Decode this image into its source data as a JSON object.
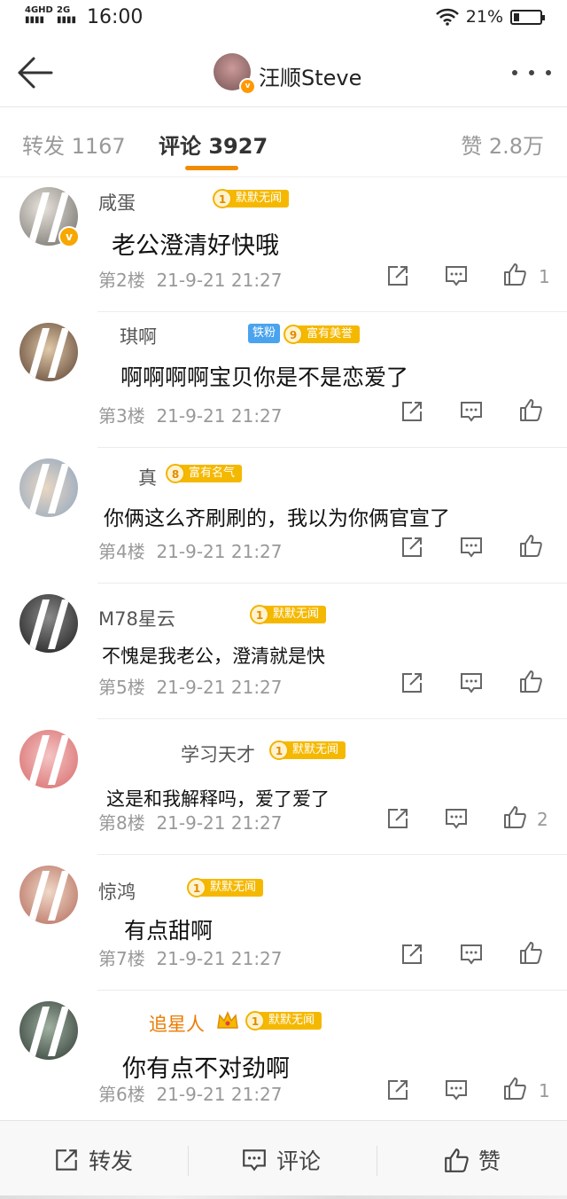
{
  "status_bar": {
    "net1": "4GHD",
    "net2": "2G",
    "time": "16:00",
    "battery": "21%"
  },
  "header": {
    "title": "汪顺Steve",
    "verified_mark": "v"
  },
  "tabs": [
    {
      "label": "转发 1167",
      "active": false
    },
    {
      "label": "评论 3927",
      "active": true
    },
    {
      "label": "赞 2.8万",
      "active": false
    }
  ],
  "comments": [
    {
      "name": "咸蛋",
      "badge_level": "1",
      "badge_text": "默默无闻",
      "text": "老公澄清好快哦",
      "floor": "第2楼",
      "time": "21-9-21 21:27",
      "likes": "1",
      "verified": "v"
    },
    {
      "name": "琪啊",
      "fan_tag": "铁粉",
      "badge_level": "9",
      "badge_text": "富有美誉",
      "text": "啊啊啊啊宝贝你是不是恋爱了",
      "floor": "第3楼",
      "time": "21-9-21 21:27",
      "likes": ""
    },
    {
      "name": "真",
      "badge_level": "8",
      "badge_text": "富有名气",
      "text": "你俩这么齐刷刷的，我以为你俩官宣了",
      "floor": "第4楼",
      "time": "21-9-21 21:27",
      "likes": ""
    },
    {
      "name": "M78星云",
      "badge_level": "1",
      "badge_text": "默默无闻",
      "text": "不愧是我老公，澄清就是快",
      "floor": "第5楼",
      "time": "21-9-21 21:27",
      "likes": ""
    },
    {
      "name": "学习天才",
      "badge_level": "1",
      "badge_text": "默默无闻",
      "text": "这是和我解释吗，爱了爱了",
      "floor": "第8楼",
      "time": "21-9-21 21:27",
      "likes": "2"
    },
    {
      "name": "惊鸿",
      "badge_level": "1",
      "badge_text": "默默无闻",
      "text": "有点甜啊",
      "floor": "第7楼",
      "time": "21-9-21 21:27",
      "likes": ""
    },
    {
      "name": "追星人",
      "badge_level": "1",
      "badge_text": "默默无闻",
      "text": "你有点不对劲啊",
      "floor": "第6楼",
      "time": "21-9-21 21:27",
      "likes": "1"
    }
  ],
  "bottom_bar": {
    "repost": "转发",
    "comment": "评论",
    "like": "赞"
  },
  "colors": {
    "accent": "#f08c00",
    "badge": "#f5b800",
    "fan": "#4aa3ee"
  }
}
